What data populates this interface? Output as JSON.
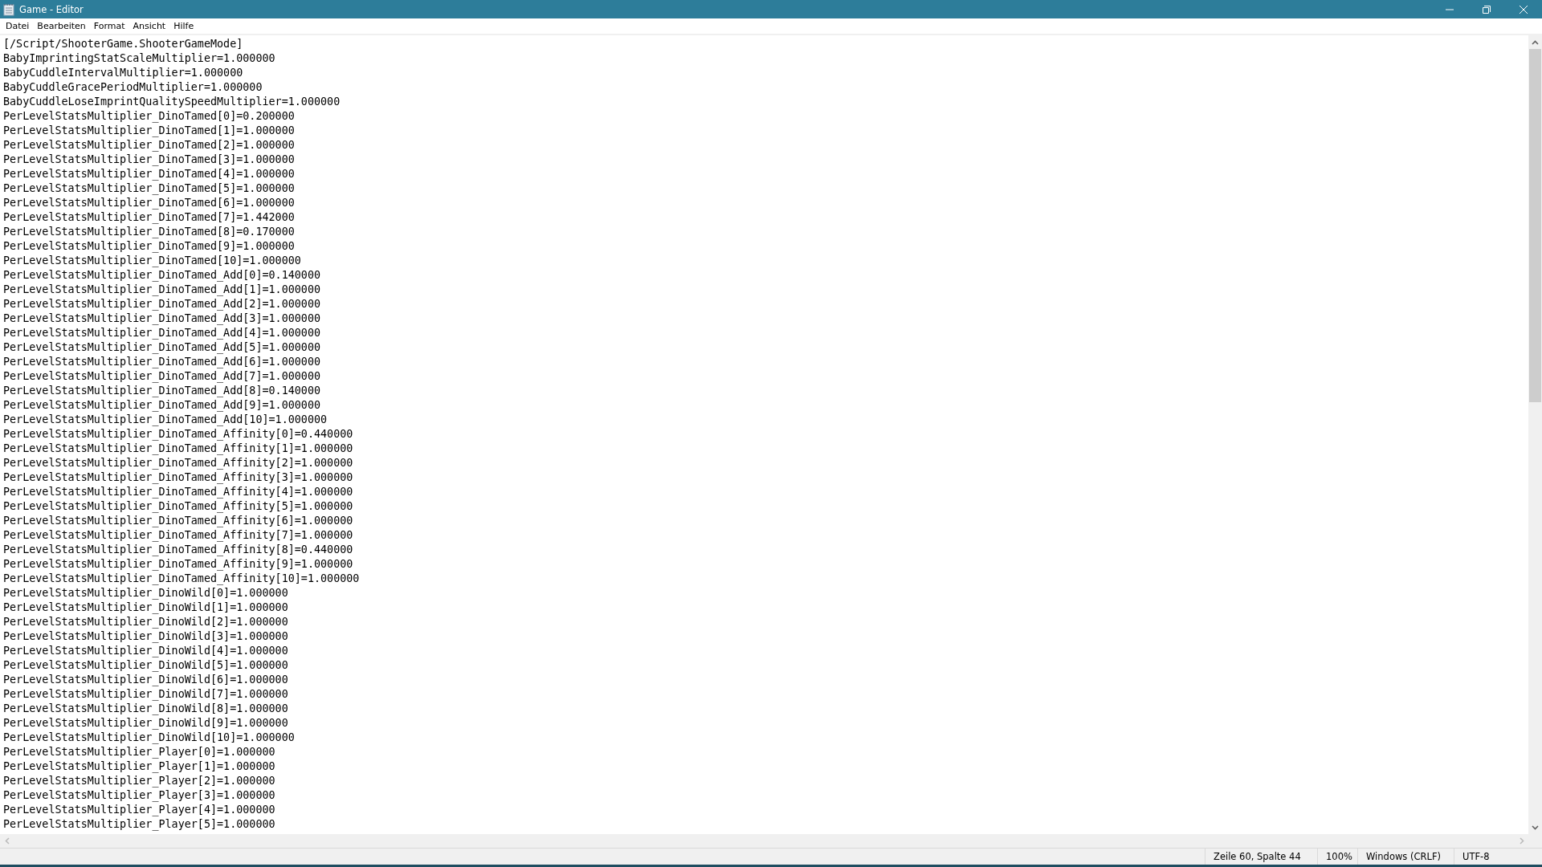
{
  "window": {
    "title": "Game - Editor"
  },
  "menu": [
    "Datei",
    "Bearbeiten",
    "Format",
    "Ansicht",
    "Hilfe"
  ],
  "lines": [
    "[/Script/ShooterGame.ShooterGameMode]",
    "BabyImprintingStatScaleMultiplier=1.000000",
    "BabyCuddleIntervalMultiplier=1.000000",
    "BabyCuddleGracePeriodMultiplier=1.000000",
    "BabyCuddleLoseImprintQualitySpeedMultiplier=1.000000",
    "PerLevelStatsMultiplier_DinoTamed[0]=0.200000",
    "PerLevelStatsMultiplier_DinoTamed[1]=1.000000",
    "PerLevelStatsMultiplier_DinoTamed[2]=1.000000",
    "PerLevelStatsMultiplier_DinoTamed[3]=1.000000",
    "PerLevelStatsMultiplier_DinoTamed[4]=1.000000",
    "PerLevelStatsMultiplier_DinoTamed[5]=1.000000",
    "PerLevelStatsMultiplier_DinoTamed[6]=1.000000",
    "PerLevelStatsMultiplier_DinoTamed[7]=1.442000",
    "PerLevelStatsMultiplier_DinoTamed[8]=0.170000",
    "PerLevelStatsMultiplier_DinoTamed[9]=1.000000",
    "PerLevelStatsMultiplier_DinoTamed[10]=1.000000",
    "PerLevelStatsMultiplier_DinoTamed_Add[0]=0.140000",
    "PerLevelStatsMultiplier_DinoTamed_Add[1]=1.000000",
    "PerLevelStatsMultiplier_DinoTamed_Add[2]=1.000000",
    "PerLevelStatsMultiplier_DinoTamed_Add[3]=1.000000",
    "PerLevelStatsMultiplier_DinoTamed_Add[4]=1.000000",
    "PerLevelStatsMultiplier_DinoTamed_Add[5]=1.000000",
    "PerLevelStatsMultiplier_DinoTamed_Add[6]=1.000000",
    "PerLevelStatsMultiplier_DinoTamed_Add[7]=1.000000",
    "PerLevelStatsMultiplier_DinoTamed_Add[8]=0.140000",
    "PerLevelStatsMultiplier_DinoTamed_Add[9]=1.000000",
    "PerLevelStatsMultiplier_DinoTamed_Add[10]=1.000000",
    "PerLevelStatsMultiplier_DinoTamed_Affinity[0]=0.440000",
    "PerLevelStatsMultiplier_DinoTamed_Affinity[1]=1.000000",
    "PerLevelStatsMultiplier_DinoTamed_Affinity[2]=1.000000",
    "PerLevelStatsMultiplier_DinoTamed_Affinity[3]=1.000000",
    "PerLevelStatsMultiplier_DinoTamed_Affinity[4]=1.000000",
    "PerLevelStatsMultiplier_DinoTamed_Affinity[5]=1.000000",
    "PerLevelStatsMultiplier_DinoTamed_Affinity[6]=1.000000",
    "PerLevelStatsMultiplier_DinoTamed_Affinity[7]=1.000000",
    "PerLevelStatsMultiplier_DinoTamed_Affinity[8]=0.440000",
    "PerLevelStatsMultiplier_DinoTamed_Affinity[9]=1.000000",
    "PerLevelStatsMultiplier_DinoTamed_Affinity[10]=1.000000",
    "PerLevelStatsMultiplier_DinoWild[0]=1.000000",
    "PerLevelStatsMultiplier_DinoWild[1]=1.000000",
    "PerLevelStatsMultiplier_DinoWild[2]=1.000000",
    "PerLevelStatsMultiplier_DinoWild[3]=1.000000",
    "PerLevelStatsMultiplier_DinoWild[4]=1.000000",
    "PerLevelStatsMultiplier_DinoWild[5]=1.000000",
    "PerLevelStatsMultiplier_DinoWild[6]=1.000000",
    "PerLevelStatsMultiplier_DinoWild[7]=1.000000",
    "PerLevelStatsMultiplier_DinoWild[8]=1.000000",
    "PerLevelStatsMultiplier_DinoWild[9]=1.000000",
    "PerLevelStatsMultiplier_DinoWild[10]=1.000000",
    "PerLevelStatsMultiplier_Player[0]=1.000000",
    "PerLevelStatsMultiplier_Player[1]=1.000000",
    "PerLevelStatsMultiplier_Player[2]=1.000000",
    "PerLevelStatsMultiplier_Player[3]=1.000000",
    "PerLevelStatsMultiplier_Player[4]=1.000000",
    "PerLevelStatsMultiplier_Player[5]=1.000000"
  ],
  "status_bar": {
    "position": "Zeile 60, Spalte 44",
    "zoom": "100%",
    "line_ending": "Windows (CRLF)",
    "encoding": "UTF-8"
  }
}
